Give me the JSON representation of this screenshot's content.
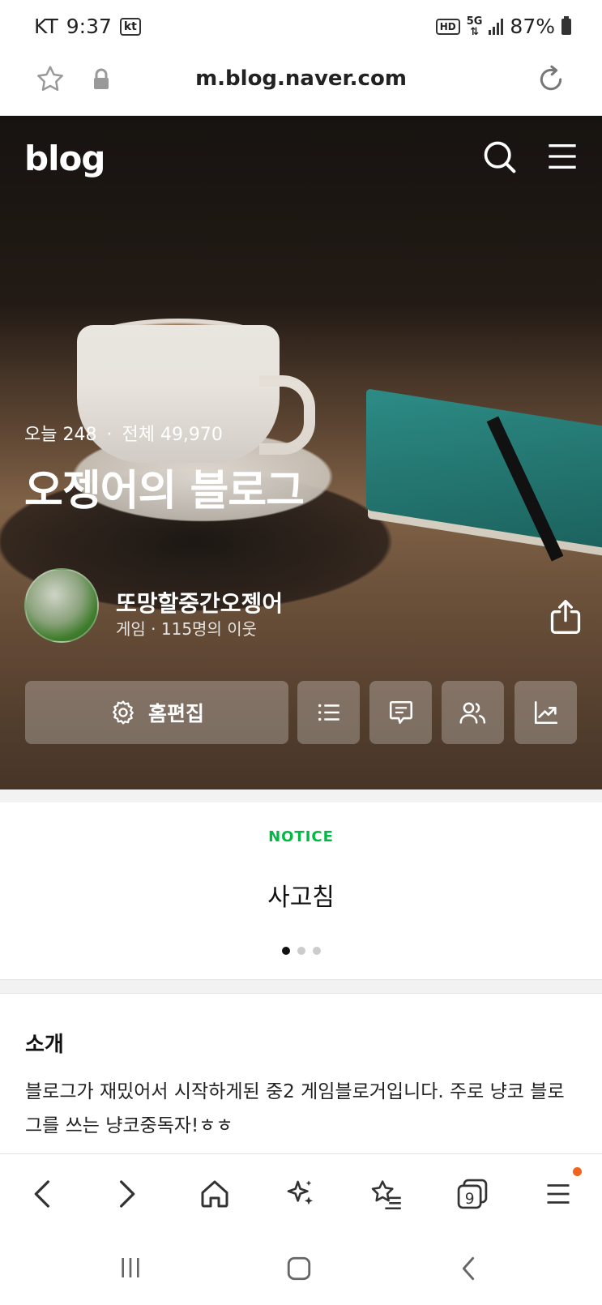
{
  "status_bar": {
    "carrier": "KT",
    "time": "9:37",
    "carrier_badge": "kt",
    "hd_badge": "HD",
    "network": "5G",
    "battery": "87%"
  },
  "address_bar": {
    "url": "m.blog.naver.com"
  },
  "header": {
    "logo": "blog"
  },
  "hero": {
    "today_label": "오늘 248",
    "separator": "·",
    "total_label": "전체 49,970",
    "blog_title": "오젱어의 블로그",
    "nickname": "또망할중간오젱어",
    "sub_info": "게임 · 115명의 이웃",
    "edit_button_label": "홈편집"
  },
  "notice": {
    "label": "NOTICE",
    "text": "사고침",
    "pages": 3,
    "current_page": 1
  },
  "intro": {
    "title": "소개",
    "text": "블로그가 재밌어서 시작하게된 중2 게임블로거입니다. 주로 냥코 블로그를 쓰는 냥코중독자!ㅎㅎ"
  },
  "toolbar": {
    "tab_count": "9"
  },
  "colors": {
    "notice_green": "#00b843",
    "badge_orange": "#f0641e"
  }
}
